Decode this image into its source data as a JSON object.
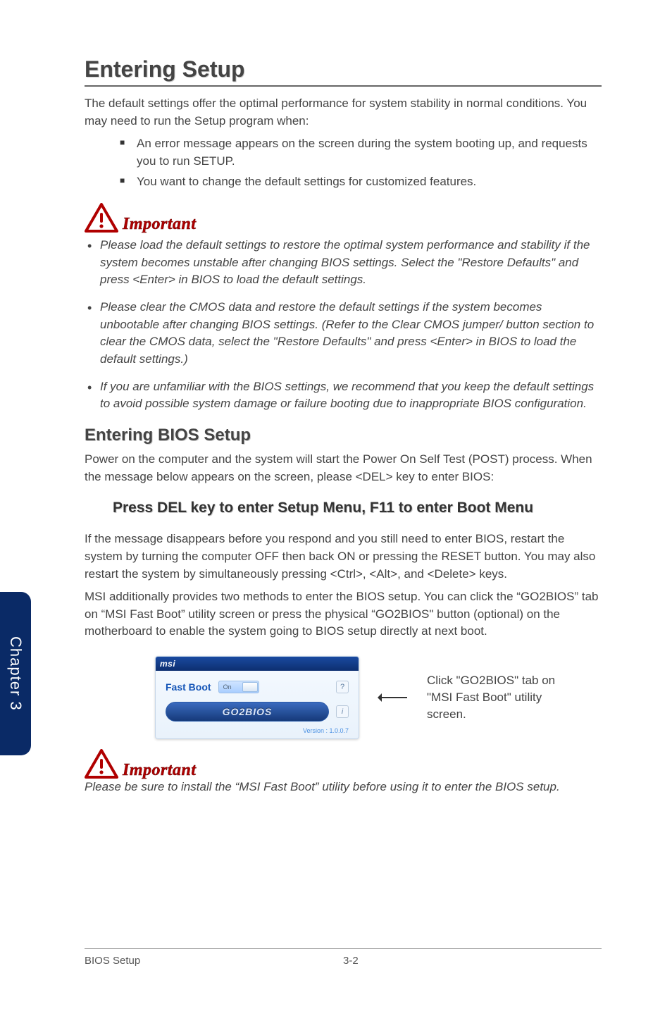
{
  "heading": "Entering Setup",
  "intro": "The default settings offer the optimal performance for system stability in normal conditions. You may need to run the Setup program when:",
  "intro_bullets": [
    "An error message appears on the screen during the system booting up, and requests you to run SETUP.",
    "You want to change the default settings for customized features."
  ],
  "important_label": "Important",
  "important_items": [
    "Please load the default settings to restore the optimal system performance and stability if the system becomes unstable after changing BIOS settings. Select the \"Restore Defaults\" and press <Enter> in BIOS to load the default settings.",
    "Please clear the CMOS data and restore the default settings if the system becomes unbootable after changing BIOS settings. (Refer to the Clear CMOS jumper/ button section to clear the CMOS data, select the \"Restore Defaults\" and press <Enter> in BIOS to load the default settings.)",
    "If you are unfamiliar with the BIOS settings, we recommend that you keep the default settings to avoid possible system damage or failure booting due to inappropriate BIOS configuration."
  ],
  "sub_heading": "Entering BIOS Setup",
  "sub_body": "Power on the computer and the system will start the Power On Self Test (POST) process. When the message below appears on the screen, please <DEL> key to enter BIOS:",
  "press_line": "Press DEL key to enter Setup Menu, F11 to enter Boot Menu",
  "after_press_1": "If the message disappears before you respond and you still need to enter BIOS, restart the system by turning the computer OFF then back ON or pressing the RESET button. You may also restart the system by simultaneously pressing <Ctrl>, <Alt>, and <Delete> keys.",
  "after_press_2": "MSI additionally provides two methods to enter the BIOS setup. You can click the “GO2BIOS” tab on “MSI Fast Boot” utility screen or press the physical “GO2BIOS\" button (optional) on the motherboard to enable the system going to BIOS setup directly at next boot.",
  "fastboot": {
    "brand": "msi",
    "label": "Fast Boot",
    "toggle_on": "On",
    "help": "?",
    "go2bios": "GO2BIOS",
    "info": "i",
    "version": "Version : 1.0.0.7"
  },
  "fastboot_caption": "Click \"GO2BIOS\" tab on \"MSI Fast Boot\" utility screen.",
  "important2_note": "Please be sure to install the “MSI Fast Boot” utility before using it to enter the BIOS setup.",
  "side_tab": "Chapter 3",
  "footer": {
    "left": "BIOS Setup",
    "page": "3-2"
  }
}
